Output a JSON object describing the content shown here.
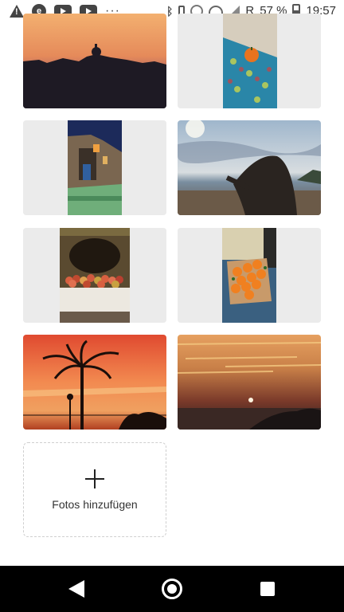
{
  "status_bar": {
    "icons_left": [
      "warning-icon",
      "notification-e-icon",
      "youtube-icon",
      "youtube-icon",
      "more-dots-icon"
    ],
    "more_dots": "···",
    "roaming": "R",
    "battery": "57 %",
    "time": "19:57"
  },
  "photos": [
    {
      "name": "photo-sunset-town-silhouette",
      "colors": [
        "#f0a070",
        "#d67050",
        "#2a2030"
      ]
    },
    {
      "name": "photo-tiled-table-orange",
      "colors": [
        "#d9d2c2",
        "#2a86a8",
        "#e07020"
      ]
    },
    {
      "name": "photo-night-doorway",
      "colors": [
        "#1a2a60",
        "#c09050",
        "#7ab080"
      ]
    },
    {
      "name": "photo-beach-legs",
      "colors": [
        "#a8bcd0",
        "#5b6d80",
        "#2a2520"
      ]
    },
    {
      "name": "photo-oven-fruit",
      "colors": [
        "#3a3020",
        "#d06040",
        "#e8e4dc"
      ]
    },
    {
      "name": "photo-oranges-tray",
      "colors": [
        "#d8d0b0",
        "#f08020",
        "#3a6080"
      ]
    },
    {
      "name": "photo-palm-sunset",
      "colors": [
        "#f07040",
        "#e05030",
        "#1a1010"
      ]
    },
    {
      "name": "photo-sea-sunset",
      "colors": [
        "#d08a50",
        "#9a4a30",
        "#2a2020"
      ]
    }
  ],
  "add_photos": {
    "label": "Fotos hinzufügen"
  }
}
